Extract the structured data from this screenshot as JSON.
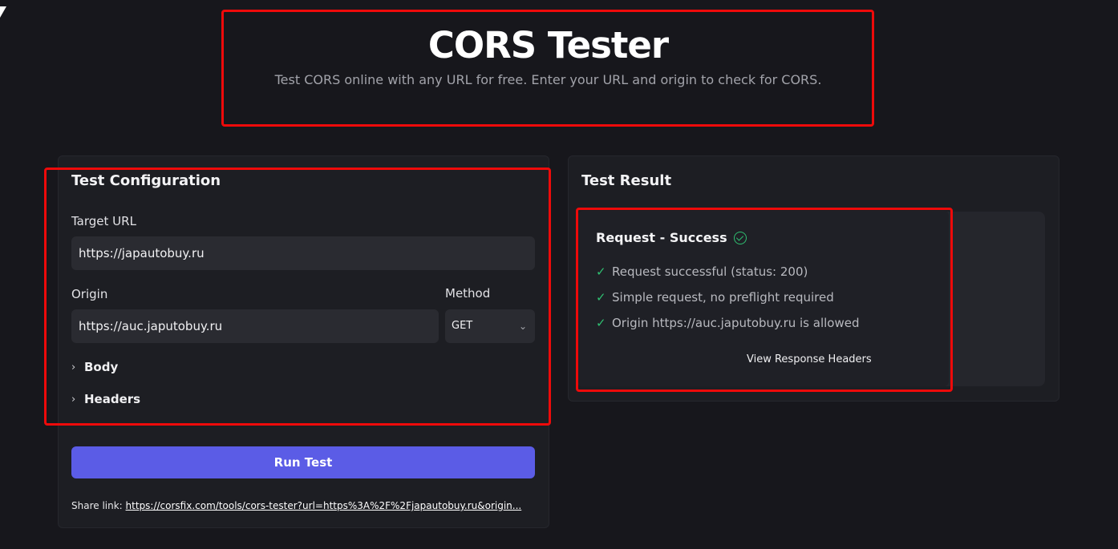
{
  "header": {
    "title": "CORS Tester",
    "subtitle": "Test CORS online with any URL for free. Enter your URL and origin to check for CORS."
  },
  "config": {
    "title": "Test Configuration",
    "target_url_label": "Target URL",
    "target_url_value": "https://japautobuy.ru",
    "origin_label": "Origin",
    "origin_value": "https://auc.japutobuy.ru",
    "method_label": "Method",
    "method_value": "GET",
    "body_label": "Body",
    "headers_label": "Headers",
    "run_button": "Run Test",
    "share_label": "Share link:",
    "share_url": "https://corsfix.com/tools/cors-tester?url=https%3A%2F%2Fjapautobuy.ru&origin..."
  },
  "result": {
    "title": "Test Result",
    "status_heading": "Request - Success",
    "checks": [
      "Request successful (status: 200)",
      "Simple request, no preflight required",
      "Origin https://auc.japutobuy.ru is allowed"
    ],
    "view_headers": "View Response Headers"
  },
  "icons": {
    "tick": "✓",
    "chevron_right": "›",
    "chevron_down": "⌄"
  },
  "colors": {
    "accent": "#5b5ce6",
    "success": "#2fbf71",
    "annotation": "#ee0a0a",
    "background": "#17171c"
  }
}
